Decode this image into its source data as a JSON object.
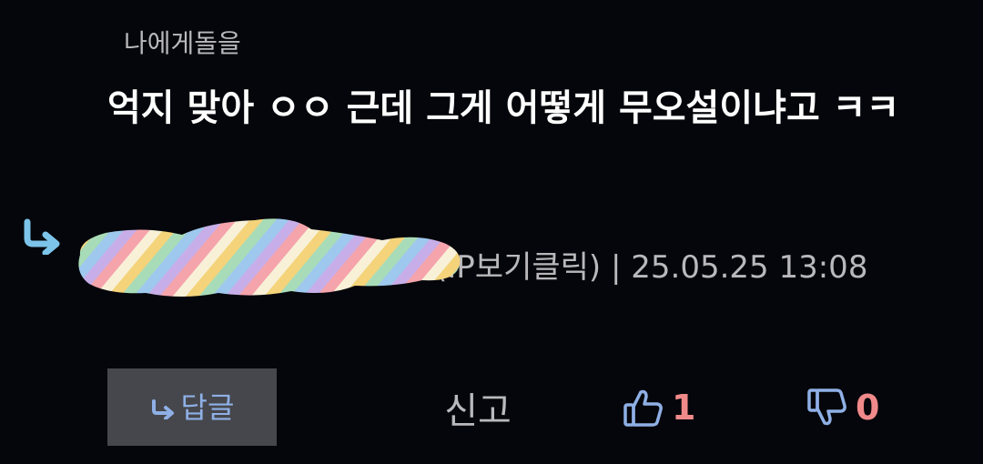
{
  "comment": {
    "reply_to": "나에게돌을",
    "body": "억지 맞아 ㅇㅇ 근데 그게 어떻게 무오설이냐고 ㅋㅋ",
    "meta": "(IP보기클릭) | 25.05.25 13:08"
  },
  "actions": {
    "reply_label": "답글",
    "report_label": "신고",
    "upvote_count": "1",
    "downvote_count": "0"
  },
  "icons": {
    "reply_arrow": "reply-arrow-icon",
    "redaction": "rainbow-redaction",
    "thumb_up": "thumbs-up-icon",
    "thumb_down": "thumbs-down-icon"
  },
  "colors": {
    "background": "#05060b",
    "text_primary": "#ffffff",
    "text_secondary": "#b9b9bd",
    "accent_blue": "#8fb0e6",
    "reply_arrow": "#7cc4ea",
    "count_red": "#f08a8a",
    "button_bg": "#46474c"
  }
}
